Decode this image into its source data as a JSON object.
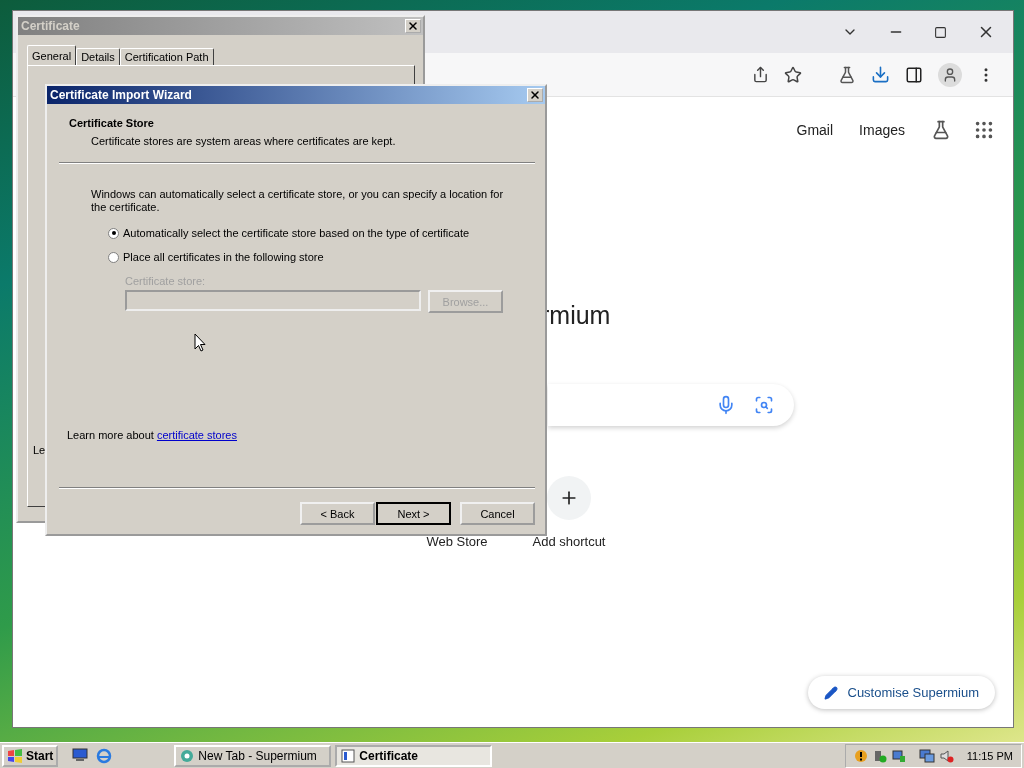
{
  "browser": {
    "toolbar_links": [
      "Gmail",
      "Images"
    ],
    "logo_text": "rmium",
    "shortcuts": [
      {
        "label": "Web Store"
      },
      {
        "label": "Add shortcut"
      }
    ],
    "customise_button": "Customise Supermium"
  },
  "certificate_window": {
    "title": "Certificate",
    "tabs": [
      {
        "label": "General",
        "selected": true
      },
      {
        "label": "Details",
        "selected": false
      },
      {
        "label": "Certification Path",
        "selected": false
      }
    ],
    "cut_text": "Le"
  },
  "wizard": {
    "title": "Certificate Import Wizard",
    "heading": "Certificate Store",
    "subheading": "Certificate stores are system areas where certificates are kept.",
    "description": "Windows can automatically select a certificate store, or you can specify a location for the certificate.",
    "options": [
      {
        "label": "Automatically select the certificate store based on the type of certificate",
        "selected": true
      },
      {
        "label": "Place all certificates in the following store",
        "selected": false
      }
    ],
    "store": {
      "label": "Certificate store:",
      "button": "Browse...",
      "disabled": true
    },
    "learn_more": {
      "text": "Learn more about",
      "link": "certificate stores"
    },
    "buttons": [
      {
        "label": "< Back",
        "default": false
      },
      {
        "label": "Next >",
        "default": true
      },
      {
        "label": "Cancel",
        "default": false
      }
    ]
  },
  "taskbar": {
    "start": "Start",
    "tasks": [
      {
        "label": "New Tab - Supermium",
        "selected": false
      },
      {
        "label": "Certificate",
        "selected": true
      }
    ],
    "clock": "11:15 PM"
  }
}
